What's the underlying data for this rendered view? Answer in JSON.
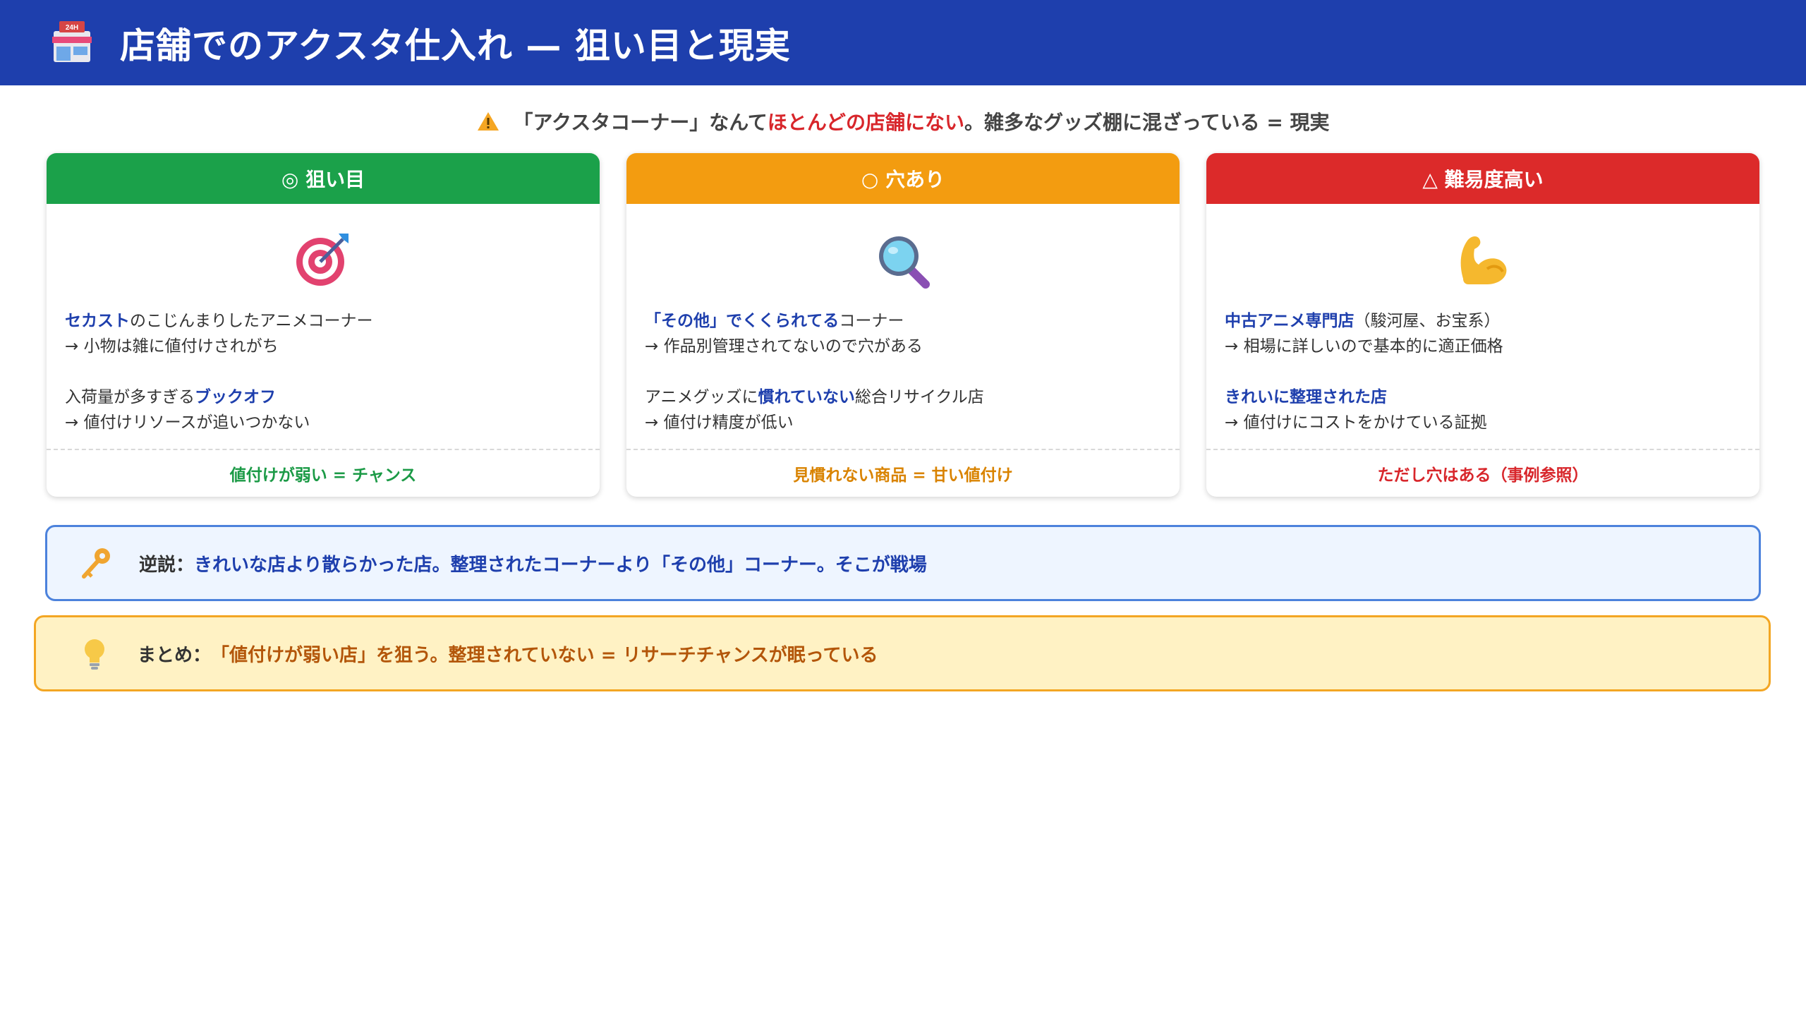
{
  "header": {
    "title": "店舗でのアクスタ仕入れ — 狙い目と現実",
    "icon_badge": "24H"
  },
  "warning": {
    "before": "「アクスタコーナー」なんて",
    "emphasis": "ほとんどの店舗にない",
    "after": "。雑多なグッズ棚に混ざっている = 現実"
  },
  "cards": [
    {
      "head_label": "◎ 狙い目",
      "head_color": "#1ba14a",
      "icon": "target-dart-icon",
      "item1_em": "セカスト",
      "item1_text": "のこじんまりしたアニメコーナー",
      "item1_sub": "→ 小物は雑に値付けされがち",
      "item2_text": "入荷量が多すぎる",
      "item2_em": "ブックオフ",
      "item2_sub": "→ 値付けリソースが追いつかない",
      "footer": "値付けが弱い = チャンス",
      "footer_color": "#1b9a46"
    },
    {
      "head_label": "○ 穴あり",
      "head_color": "#f39c10",
      "icon": "magnifier-icon",
      "item1_em": "「その他」でくくられてる",
      "item1_text": "コーナー",
      "item1_sub": "→ 作品別管理されてないので穴がある",
      "item2_text": "アニメグッズに",
      "item2_em": "慣れていない",
      "item2_text2": "総合リサイクル店",
      "item2_sub": "→ 値付け精度が低い",
      "footer": "見慣れない商品 = 甘い値付け",
      "footer_color": "#d98300"
    },
    {
      "head_label": "△ 難易度高い",
      "head_color": "#dc2a2a",
      "icon": "flexed-bicep-icon",
      "item1_em": "中古アニメ専門店",
      "item1_text": "（駿河屋、お宝系）",
      "item1_sub": "→ 相場に詳しいので基本的に適正価格",
      "item2_em": "きれいに整理された店",
      "item2_sub": "→ 値付けにコストをかけている証拠",
      "footer": "ただし穴はある（事例参照）",
      "footer_color": "#d8262b"
    }
  ],
  "paradox": {
    "label": "逆説：",
    "text": "きれいな店より散らかった店。整理されたコーナーより「その他」コーナー。そこが戦場"
  },
  "summary": {
    "label": "まとめ：",
    "text": "「値付けが弱い店」を狙う。整理されていない = リサーチチャンスが眠っている"
  }
}
